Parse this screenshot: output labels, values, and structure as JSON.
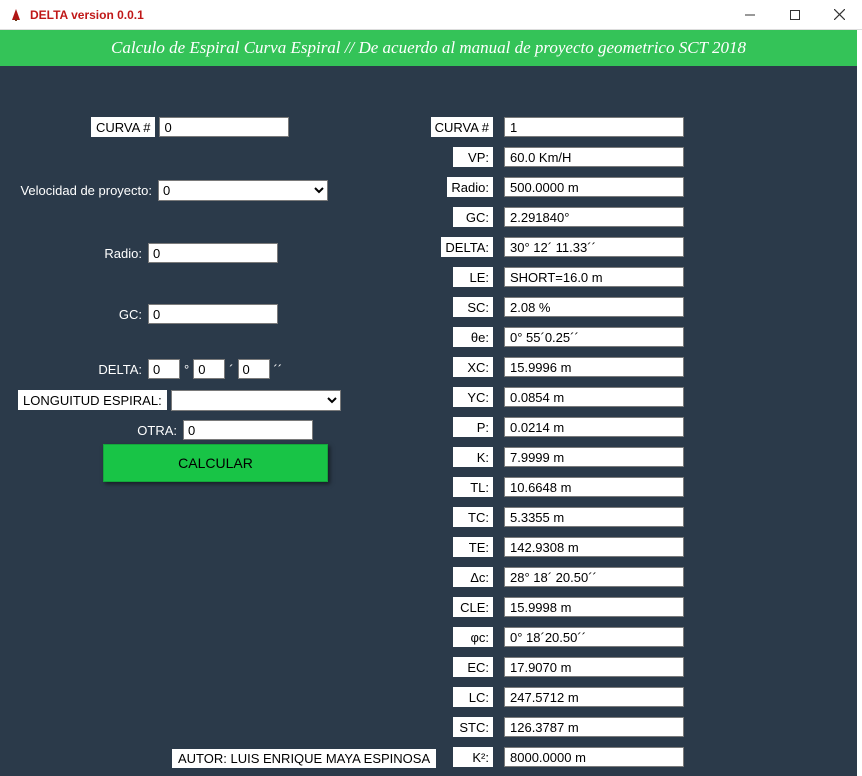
{
  "window": {
    "title": "DELTA version 0.0.1"
  },
  "header": {
    "title": "Calculo de Espiral Curva Espiral // De acuerdo al manual de proyecto geometrico SCT 2018"
  },
  "inputs": {
    "curva_label": "CURVA #",
    "curva_value": "0",
    "vp_label": "Velocidad de proyecto:",
    "vp_value": "0",
    "radio_label": "Radio:",
    "radio_value": "0",
    "gc_label": "GC:",
    "gc_value": "0",
    "delta_label": "DELTA:",
    "delta_deg": "0",
    "delta_min": "0",
    "delta_sec": "0",
    "deg_sym": "°",
    "min_sym": "´",
    "sec_sym": "´´",
    "le_label": "LONGUITUD ESPIRAL:",
    "le_value": "",
    "otra_label": "OTRA:",
    "otra_value": "0",
    "calc_label": "CALCULAR"
  },
  "outputs": [
    {
      "label": "CURVA #",
      "value": "1"
    },
    {
      "label": "VP:",
      "value": "60.0 Km/H"
    },
    {
      "label": "Radio:",
      "value": "500.0000 m"
    },
    {
      "label": "GC:",
      "value": "2.291840°"
    },
    {
      "label": "DELTA:",
      "value": "30° 12´ 11.33´´"
    },
    {
      "label": "LE:",
      "value": "SHORT=16.0 m"
    },
    {
      "label": "SC:",
      "value": "2.08 %"
    },
    {
      "label": "θe:",
      "value": "0° 55´0.25´´"
    },
    {
      "label": "XC:",
      "value": "15.9996 m"
    },
    {
      "label": "YC:",
      "value": "0.0854 m"
    },
    {
      "label": "P:",
      "value": "0.0214 m"
    },
    {
      "label": "K:",
      "value": "7.9999 m"
    },
    {
      "label": "TL:",
      "value": "10.6648 m"
    },
    {
      "label": "TC:",
      "value": "5.3355 m"
    },
    {
      "label": "TE:",
      "value": "142.9308 m"
    },
    {
      "label": "Δc:",
      "value": "28° 18´ 20.50´´"
    },
    {
      "label": "CLE:",
      "value": "15.9998 m"
    },
    {
      "label": "φc:",
      "value": "0° 18´20.50´´"
    },
    {
      "label": "EC:",
      "value": "17.9070 m"
    },
    {
      "label": "LC:",
      "value": "247.5712 m"
    },
    {
      "label": "STC:",
      "value": "126.3787 m"
    },
    {
      "label": "K²:",
      "value": "8000.0000 m"
    }
  ],
  "footer": {
    "author": "AUTOR: LUIS ENRIQUE MAYA ESPINOSA"
  }
}
